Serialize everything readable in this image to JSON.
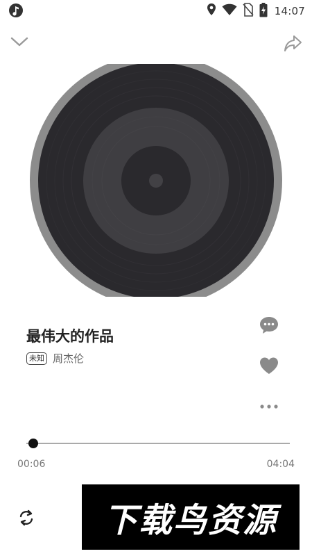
{
  "status_bar": {
    "time": "14:07",
    "icons": [
      "music-note-icon",
      "location-icon",
      "wifi-icon",
      "no-sim-icon",
      "battery-charging-icon"
    ]
  },
  "top_bar": {
    "left_icon": "chevron-down-icon",
    "right_icon": "share-icon"
  },
  "song": {
    "title": "最伟大的作品",
    "quality_badge": "未知",
    "artist": "周杰伦"
  },
  "actions": {
    "comment_icon": "comment-icon",
    "like_icon": "heart-icon",
    "more_icon": "more-icon"
  },
  "progress": {
    "current_time": "00:06",
    "total_time": "04:04",
    "fraction": 0.025
  },
  "controls": {
    "repeat_icon": "repeat-icon"
  },
  "watermark": {
    "text": "下载鸟资源"
  },
  "colors": {
    "disc_rim": "#8c8c8c",
    "disc_outer": "#2a292d",
    "disc_mid": "#3f3e42",
    "disc_label": "#2a292d",
    "progress_track": "#aaaaaa",
    "progress_thumb": "#111111",
    "icon_gray": "#8a8a8a"
  }
}
